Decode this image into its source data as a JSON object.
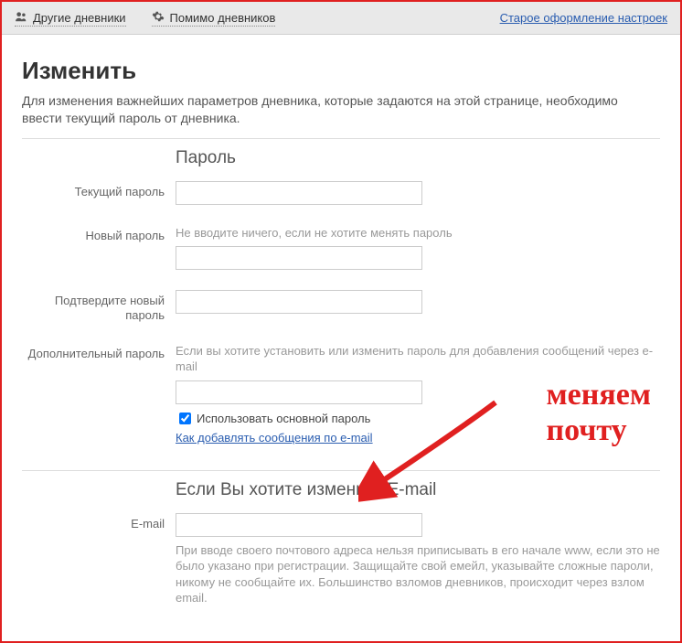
{
  "topbar": {
    "other_diaries": "Другие дневники",
    "beyond_diaries": "Помимо дневников",
    "old_design": "Старое оформление настроек"
  },
  "page": {
    "title": "Изменить",
    "intro": "Для изменения важнейших параметров дневника, которые задаются на этой странице, необходимо ввести текущий пароль от дневника."
  },
  "password_section": {
    "title": "Пароль",
    "current_label": "Текущий пароль",
    "new_label": "Новый пароль",
    "new_hint": "Не вводите ничего, если не хотите менять пароль",
    "confirm_label": "Подтвердите новый пароль",
    "extra_label": "Дополнительный пароль",
    "extra_hint": "Если вы хотите установить или изменить пароль для добавления сообщений через e-mail",
    "use_main_checkbox": "Использовать основной пароль",
    "email_howto_link": "Как добавлять сообщения по e-mail"
  },
  "email_section": {
    "title": "Если Вы хотите изменить E-mail",
    "label": "E-mail",
    "hint": "При вводе своего почтового адреса нельзя приписывать в его начале www, если это не было указано при регистрации. Защищайте свой емейл, указывайте сложные пароли, никому не сообщайте их. Большинство взломов дневников, происходит через взлом email."
  },
  "annotation": "меняем почту"
}
